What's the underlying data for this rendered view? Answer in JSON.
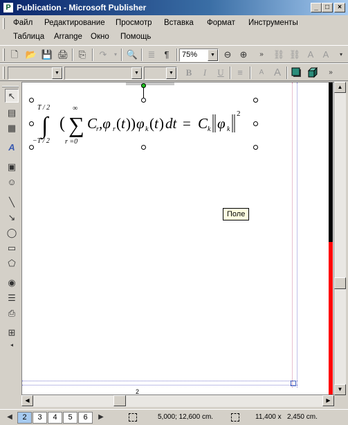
{
  "window": {
    "title": "Publication - Microsoft Publisher",
    "app_icon": "publisher-icon",
    "buttons": [
      "minimize-icon",
      "maximize-icon",
      "close-icon"
    ]
  },
  "menu": {
    "row1": [
      "Файл",
      "Редактирование",
      "Просмотр",
      "Вставка",
      "Формат",
      "Инструменты"
    ],
    "row2": [
      "Таблица",
      "Arrange",
      "Окно",
      "Помощь"
    ]
  },
  "toolbar": {
    "zoom": "75%",
    "pilcrow": "¶"
  },
  "formatting": {
    "style_value": "",
    "font_value": "",
    "size_value": "",
    "bold": "B",
    "italic": "I",
    "underline": "U"
  },
  "document": {
    "formula": {
      "int_upper": "T / 2",
      "int_lower": "−T / 2",
      "sum_upper": "∞",
      "sum_lower": "r =0",
      "body": "C",
      "exponent": "2"
    },
    "tooltip": "Поле",
    "page_number": "2"
  },
  "status": {
    "pages": [
      "2",
      "3",
      "4",
      "5",
      "6"
    ],
    "active_page": "2",
    "position": "5,000; 12,600 cm.",
    "size": "11,400 x   2,450 cm."
  },
  "colors": {
    "title_start": "#0a246a",
    "title_end": "#a6caf0",
    "chrome": "#d4d0c8",
    "tooltip_bg": "#ffffe1",
    "scroll_red": "#ff0000"
  }
}
